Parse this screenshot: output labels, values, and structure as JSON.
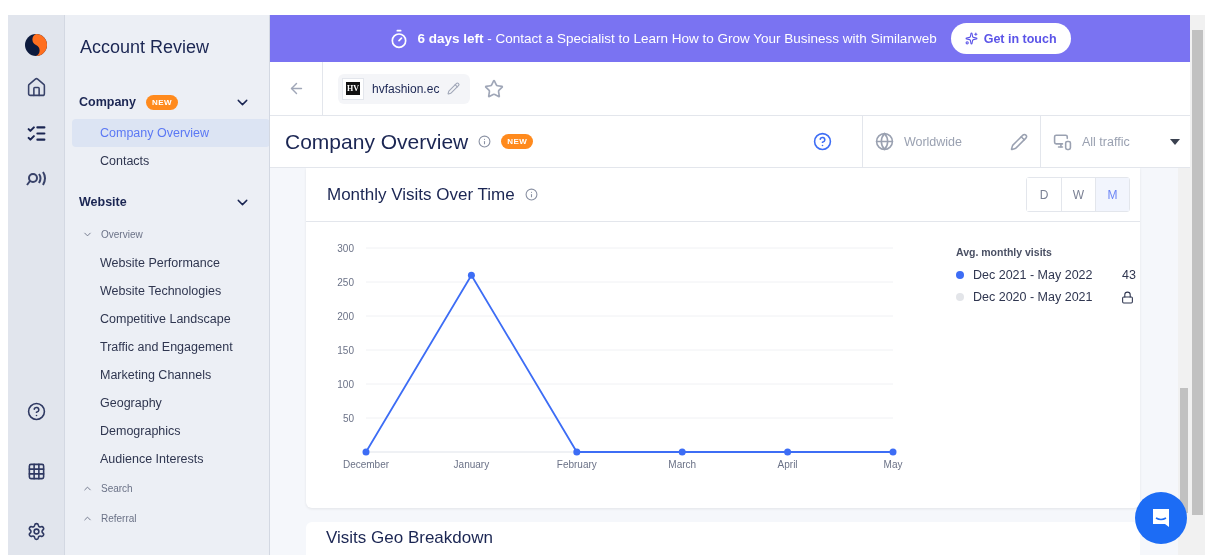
{
  "rail": {
    "items": [
      {
        "selected": false
      },
      {
        "selected": true
      },
      {
        "selected": false
      }
    ],
    "bottom_items": [
      {
        "selected": false
      },
      {
        "selected": false
      },
      {
        "selected": false
      }
    ]
  },
  "sidebar": {
    "title": "Account Review",
    "groups": [
      {
        "label": "Company",
        "badge": "NEW",
        "expanded": true,
        "children": [
          {
            "label": "Company Overview",
            "selected": true
          },
          {
            "label": "Contacts",
            "selected": false
          }
        ]
      },
      {
        "label": "Website",
        "expanded": true,
        "children": [
          {
            "label": "Overview",
            "expanded": true,
            "children": [
              {
                "label": "Website Performance",
                "selected": false
              },
              {
                "label": "Website Technologies",
                "selected": false
              },
              {
                "label": "Competitive Landscape",
                "selected": false
              },
              {
                "label": "Traffic and Engagement",
                "selected": false
              },
              {
                "label": "Marketing Channels",
                "selected": false
              },
              {
                "label": "Geography",
                "selected": false
              },
              {
                "label": "Demographics",
                "selected": false
              },
              {
                "label": "Audience Interests",
                "selected": false
              }
            ]
          },
          {
            "label": "Search",
            "expanded": false
          },
          {
            "label": "Referral",
            "expanded": false
          }
        ]
      }
    ]
  },
  "banner": {
    "message": "**6 days left** - Contact a Specialist to Learn How to Grow Your Business with Similarweb",
    "button": "Get in touch"
  },
  "domain_bar": {
    "logo_text": "HV",
    "domain": "hvfashion.ec",
    "starred": false
  },
  "page_header": {
    "title": "Company Overview",
    "badge": "NEW",
    "region": "Worldwide",
    "traffic": "All traffic"
  },
  "visits_card": {
    "title": "Monthly Visits Over Time",
    "granularity": [
      {
        "label": "D",
        "selected": false
      },
      {
        "label": "W",
        "selected": false
      },
      {
        "label": "M",
        "selected": true
      }
    ],
    "chart_data": {
      "type": "line",
      "categories": [
        "December",
        "January",
        "February",
        "March",
        "April",
        "May"
      ],
      "series": [
        {
          "name": "Dec 2021 - May 2022",
          "color": "#3d6df5",
          "marker": true,
          "values": [
            0,
            260,
            0,
            0,
            0,
            0
          ]
        }
      ],
      "grid": true,
      "ylim": [
        0,
        300
      ],
      "yticks": [
        50,
        100,
        150,
        200,
        250,
        300
      ]
    },
    "legend": {
      "title": "Avg. monthly visits",
      "items": [
        {
          "value": "43",
          "color": "#3d6df5",
          "locked": false
        },
        {
          "label": "Dec 2020 - May 2021",
          "color": "#e3e5e9",
          "locked": true
        }
      ]
    }
  },
  "geo_card": {
    "title": "Visits Geo Breakdown"
  }
}
